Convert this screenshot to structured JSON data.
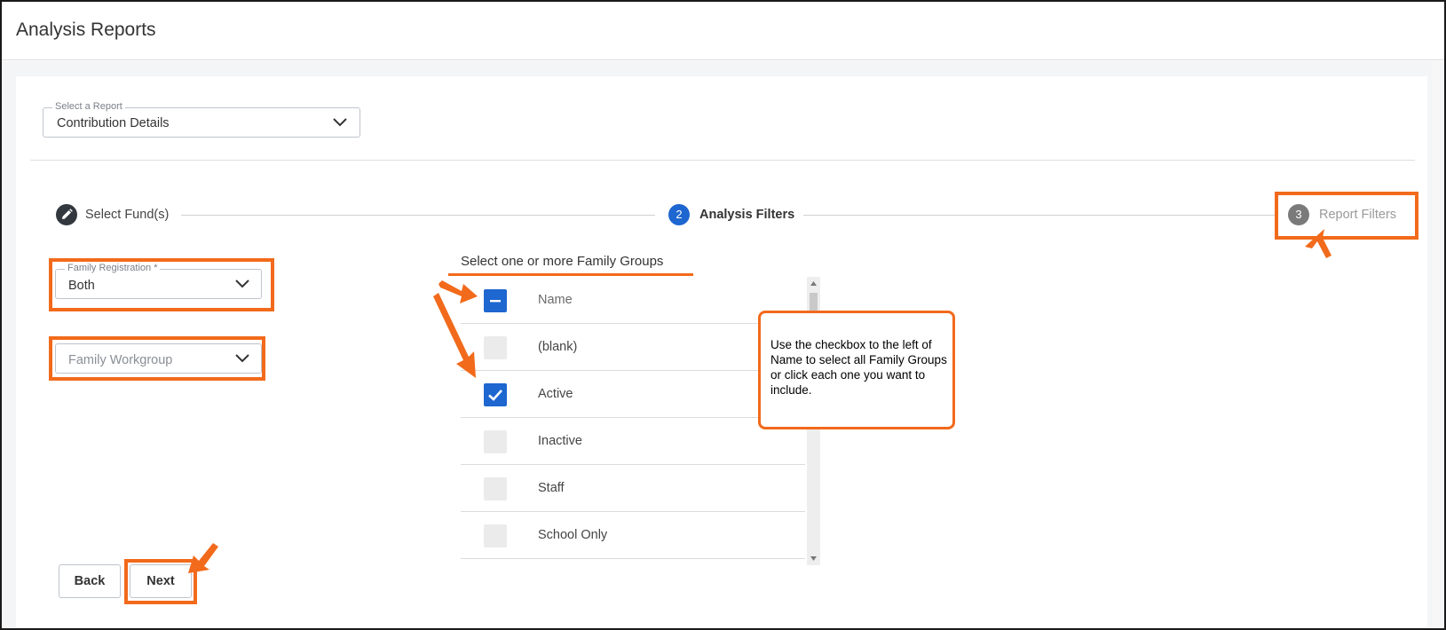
{
  "header": {
    "title": "Analysis Reports"
  },
  "report_select": {
    "label": "Select a Report",
    "value": "Contribution Details"
  },
  "stepper": {
    "steps": [
      {
        "label": "Select Fund(s)",
        "state": "completed",
        "icon": "pencil-icon"
      },
      {
        "number": "2",
        "label": "Analysis Filters",
        "state": "active"
      },
      {
        "number": "3",
        "label": "Report Filters",
        "state": "upcoming"
      }
    ]
  },
  "filters": {
    "family_registration": {
      "label": "Family Registration *",
      "value": "Both"
    },
    "family_workgroup": {
      "placeholder": "Family Workgroup"
    }
  },
  "family_groups": {
    "title": "Select one or more Family Groups",
    "header_label": "Name",
    "header_state": "indeterminate",
    "rows": [
      {
        "label": "(blank)",
        "checked": false
      },
      {
        "label": "Active",
        "checked": true
      },
      {
        "label": "Inactive",
        "checked": false
      },
      {
        "label": "Staff",
        "checked": false
      },
      {
        "label": "School Only",
        "checked": false
      }
    ]
  },
  "callout": {
    "text": "Use the checkbox to the left of Name to select all Family Groups or click each one you want to include."
  },
  "buttons": {
    "back": "Back",
    "next": "Next"
  },
  "colors": {
    "accent": "#1e66d0",
    "annotation": "#f26a1b",
    "step_completed": "#33383f",
    "step_upcoming": "#7a7a7a"
  }
}
